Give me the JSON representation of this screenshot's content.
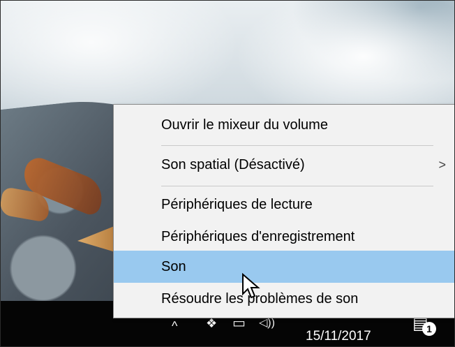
{
  "context_menu": {
    "items": [
      {
        "label": "Ouvrir le mixeur du volume",
        "submenu_arrow": ""
      },
      {
        "label": "Son spatial (Désactivé)",
        "submenu_arrow": ">"
      },
      {
        "label": "Périphériques de lecture",
        "submenu_arrow": ""
      },
      {
        "label": "Périphériques d'enregistrement",
        "submenu_arrow": ""
      },
      {
        "label": "Son",
        "submenu_arrow": "",
        "highlighted": true
      },
      {
        "label": "Résoudre les problèmes de son",
        "submenu_arrow": ""
      }
    ],
    "highlight_color": "#99c9ef"
  },
  "taskbar": {
    "icons": [
      "chevron-up-icon",
      "dropbox-icon",
      "network-icon",
      "volume-icon"
    ],
    "clock_date": "15/11/2017",
    "notification_badge": "1"
  },
  "colors": {
    "menu_bg": "#f2f2f2",
    "taskbar_bg": "#050505"
  }
}
